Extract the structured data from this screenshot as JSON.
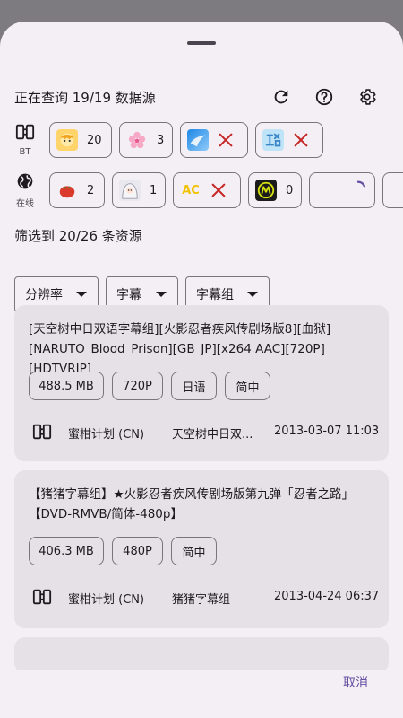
{
  "status": {
    "querying_text": "正在查询 19/19 数据源"
  },
  "toolbar": {
    "refresh_icon": "refresh-icon",
    "help_icon": "help-icon",
    "settings_icon": "gear-icon"
  },
  "bt_row": {
    "label": "BT",
    "icon": "bt-icon",
    "sources": [
      {
        "logo": "anime-girl-logo",
        "count": "20",
        "failed": false
      },
      {
        "logo": "sakura-logo",
        "count": "3",
        "failed": false
      },
      {
        "logo": "blue-wave-logo",
        "count": "",
        "failed": true
      },
      {
        "logo": "blue-glyph-logo",
        "count": "",
        "failed": true
      }
    ]
  },
  "online_row": {
    "label": "在线",
    "icon": "globe-icon",
    "sources": [
      {
        "logo": "tomato-logo",
        "count": "2",
        "failed": false
      },
      {
        "logo": "white-hair-girl-logo",
        "count": "1",
        "failed": false
      },
      {
        "logo_text": "AC",
        "count": "",
        "failed": true
      },
      {
        "logo": "yellow-m-logo",
        "count": "0",
        "failed": false
      },
      {
        "logo": "",
        "count": "",
        "loading": true
      }
    ]
  },
  "filter": {
    "summary": "筛选到 20/26 条资源",
    "dropdowns": [
      "分辨率",
      "字幕",
      "字幕组"
    ]
  },
  "results": [
    {
      "title": "[天空树中日双语字幕组][火影忍者疾风传剧场版8][血狱][NARUTO_Blood_Prison][GB_JP][x264 AAC][720P][HDTVRIP]",
      "tags": [
        "488.5 MB",
        "720P",
        "日语",
        "简中"
      ],
      "source": "蜜柑计划 (CN)",
      "group": "天空树中日双...",
      "date": "2013-03-07 11:03"
    },
    {
      "title": "【猪猪字幕组】★火影忍者疾风传剧场版第九弹「忍者之路」【DVD-RMVB/简体-480p】",
      "tags": [
        "406.3 MB",
        "480P",
        "简中"
      ],
      "source": "蜜柑计划 (CN)",
      "group": "猪猪字幕组",
      "date": "2013-04-24 06:37"
    }
  ],
  "footer": {
    "cancel_label": "取消"
  },
  "colors": {
    "sheet_bg": "#f4eff4",
    "card_bg": "#e6e1e6",
    "accent": "#6750a4",
    "error": "#c62828"
  }
}
